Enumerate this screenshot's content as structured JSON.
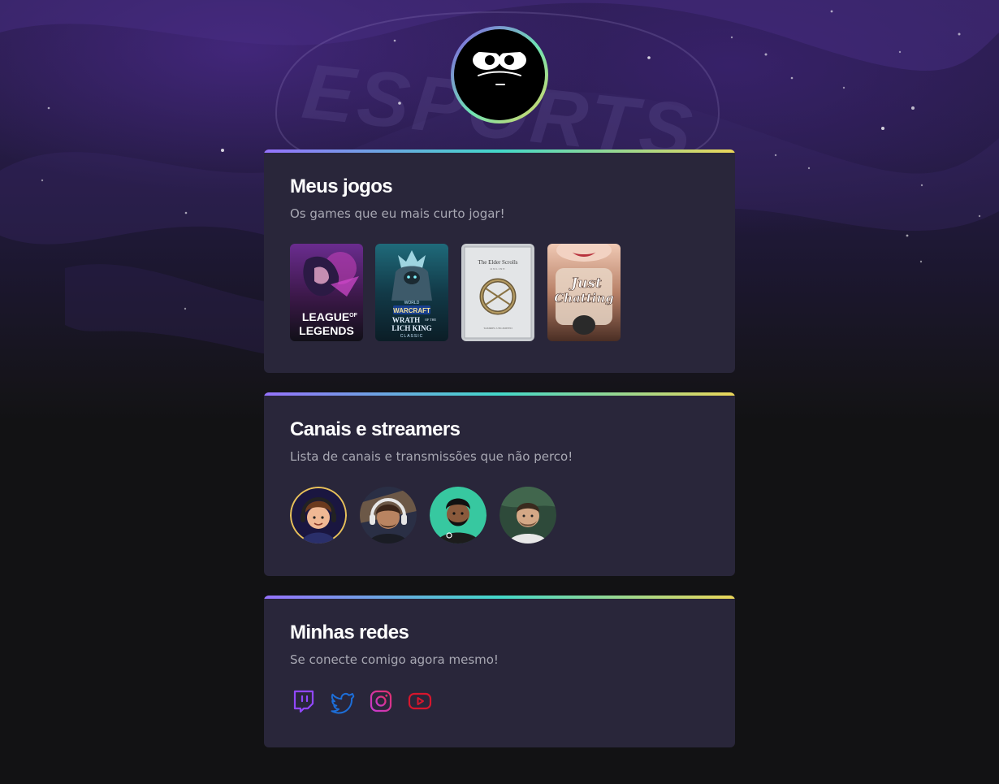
{
  "profile": {
    "avatar": "angry-black-mask-avatar",
    "background_watermark": "ESPORTS"
  },
  "sections": {
    "games": {
      "title": "Meus jogos",
      "subtitle": "Os games que eu mais curto jogar!",
      "items": [
        {
          "name": "League of Legends",
          "line1": "LEAGUE",
          "line1b": "OF",
          "line2": "LEGENDS"
        },
        {
          "name": "World of Warcraft: Wrath of the Lich King Classic",
          "top": "WORLD",
          "logo": "WARCRAFT",
          "sub1": "WRATH",
          "sub1b": "OF THE",
          "sub2": "LICH KING",
          "sub3": "CLASSIC"
        },
        {
          "name": "The Elder Scrolls Online",
          "top": "The Elder Scrolls",
          "small": "ONLINE",
          "bottom": "TAMRIEL UNLIMITED"
        },
        {
          "name": "Just Chatting",
          "line1": "Just",
          "line2": "Chatting"
        }
      ]
    },
    "streamers": {
      "title": "Canais e streamers",
      "subtitle": "Lista de canais e transmissões que não perco!",
      "items": [
        {
          "name": "streamer-1"
        },
        {
          "name": "streamer-2"
        },
        {
          "name": "streamer-3"
        },
        {
          "name": "streamer-4"
        }
      ]
    },
    "socials": {
      "title": "Minhas redes",
      "subtitle": "Se conecte comigo agora mesmo!",
      "items": [
        {
          "name": "twitch",
          "icon": "twitch-icon",
          "color": "#9147ff"
        },
        {
          "name": "twitter",
          "icon": "twitter-icon",
          "color": "#1d6ed8"
        },
        {
          "name": "instagram",
          "icon": "instagram-icon",
          "color": "#e1306c"
        },
        {
          "name": "youtube",
          "icon": "youtube-icon",
          "color": "#d7162d"
        }
      ]
    }
  },
  "colors": {
    "page_bg": "#121214",
    "card_bg": "#29263a",
    "title": "#ffffff",
    "subtitle": "#a8a8b3",
    "gradient": [
      "#9572fc",
      "#43d8c9",
      "#ebd659"
    ]
  }
}
